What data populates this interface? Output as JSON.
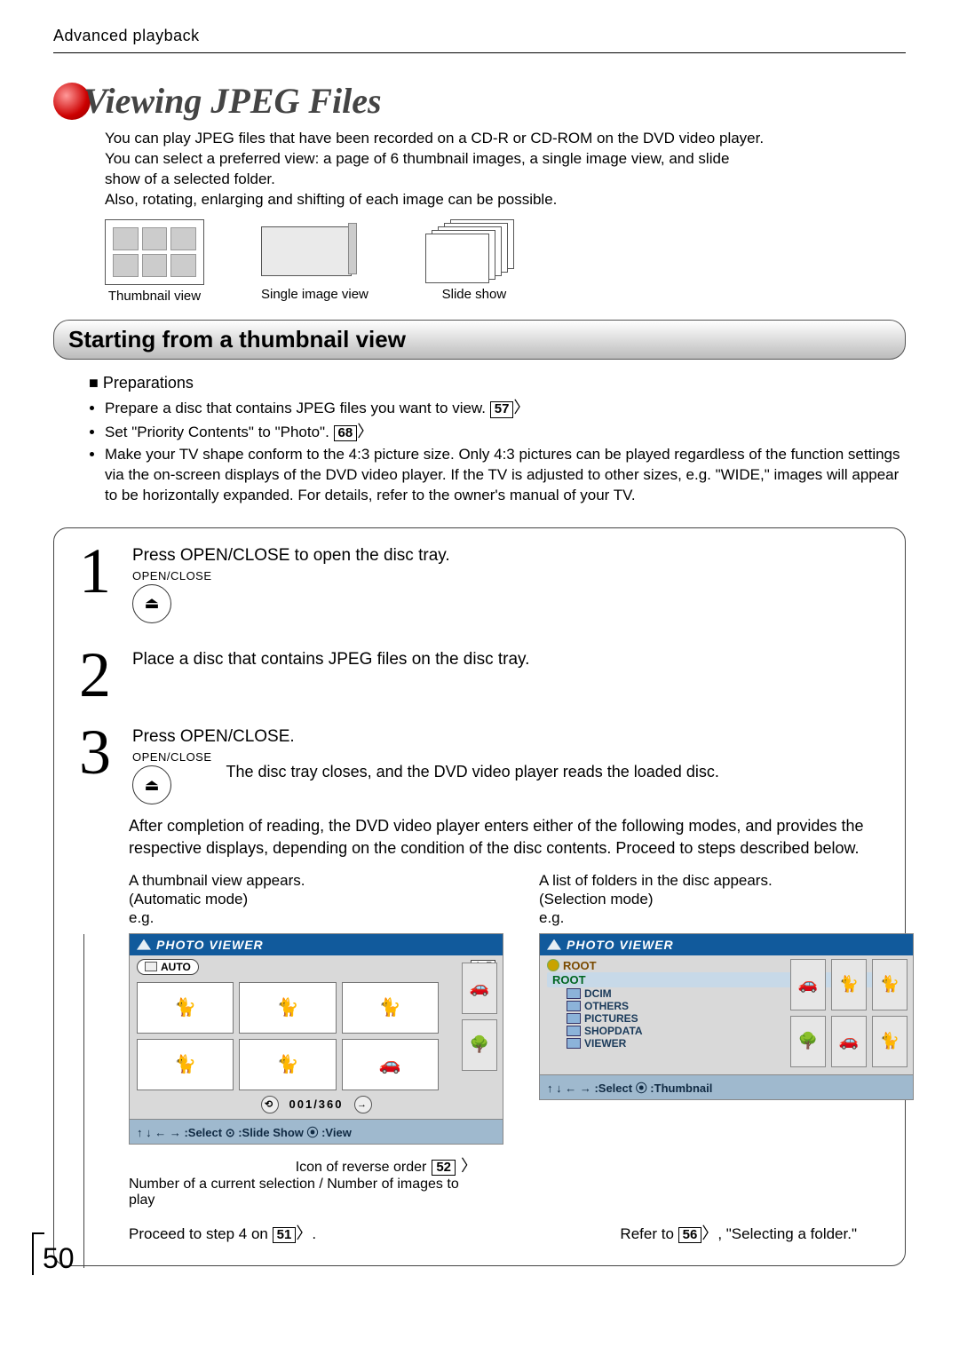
{
  "header": "Advanced playback",
  "title": "Viewing JPEG Files",
  "intro_lines": [
    "You can play JPEG files that have been recorded on a CD-R or CD-ROM on the DVD video player.",
    "You can select a preferred view: a page of 6 thumbnail images, a single image view, and slide",
    "show of a selected folder.",
    "Also, rotating, enlarging and shifting of each image can be possible."
  ],
  "icons": {
    "thumb": "Thumbnail view",
    "single": "Single image view",
    "slide": "Slide show"
  },
  "section_heading": "Starting from a thumbnail view",
  "prep": {
    "heading": "Preparations",
    "items": {
      "a": "Prepare a disc that contains JPEG files you want to view.",
      "a_ref": "57",
      "b_pre": "Set \"Priority Contents\" to \"Photo\".",
      "b_ref": "68",
      "c": "Make your TV shape conform to the 4:3 picture size.  Only 4:3 pictures can be played regardless of the function settings via the on-screen displays of the DVD video player.  If the TV is adjusted to other sizes, e.g. \"WIDE,\" images will appear to be horizontally expanded. For details, refer to the owner's manual of your TV."
    }
  },
  "steps": {
    "s1": {
      "num": "1",
      "text": "Press OPEN/CLOSE to open the disc tray.",
      "btn": "OPEN/CLOSE",
      "glyph": "⏏"
    },
    "s2": {
      "num": "2",
      "text": "Place a disc that contains JPEG files on the disc tray."
    },
    "s3": {
      "num": "3",
      "text": "Press OPEN/CLOSE.",
      "btn": "OPEN/CLOSE",
      "glyph": "⏏",
      "sub": "The disc tray closes, and the DVD video player reads the loaded disc."
    }
  },
  "after": "After completion of reading, the DVD video player enters either of the following modes, and provides the respective displays, depending on the condition of the disc contents. Proceed to steps described below.",
  "colA": {
    "cap1": "A thumbnail view appears.",
    "cap2": "(Automatic mode)",
    "eg": "e.g.",
    "viewer_title": "PHOTO VIEWER",
    "mode": "AUTO",
    "order_glyph": "A↕Z",
    "counter": "001/360",
    "hint": "↑  ↓ ← → :Select   ⊙ :Slide Show    ⦿ :View",
    "anno1_pre": "Icon of reverse order",
    "anno1_ref": "52",
    "anno2": "Number of a current selection / Number of images to play",
    "proceed_pre": "Proceed to step 4 on",
    "proceed_ref": "51",
    "proceed_post": "."
  },
  "colB": {
    "cap1": "A list of folders in the disc appears.",
    "cap2": "(Selection mode)",
    "eg": "e.g.",
    "viewer_title": "PHOTO VIEWER",
    "root1": "ROOT",
    "root2": "ROOT",
    "folders": {
      "f1": "DCIM",
      "f2": "OTHERS",
      "f3": "PICTURES",
      "f4": "SHOPDATA",
      "f5": "VIEWER"
    },
    "hint": "↑  ↓ ← → :Select    ⦿ :Thumbnail",
    "proceed_pre": "Refer to",
    "proceed_ref": "56",
    "proceed_post": ",   \"Selecting a folder.\""
  },
  "page_number": "50"
}
